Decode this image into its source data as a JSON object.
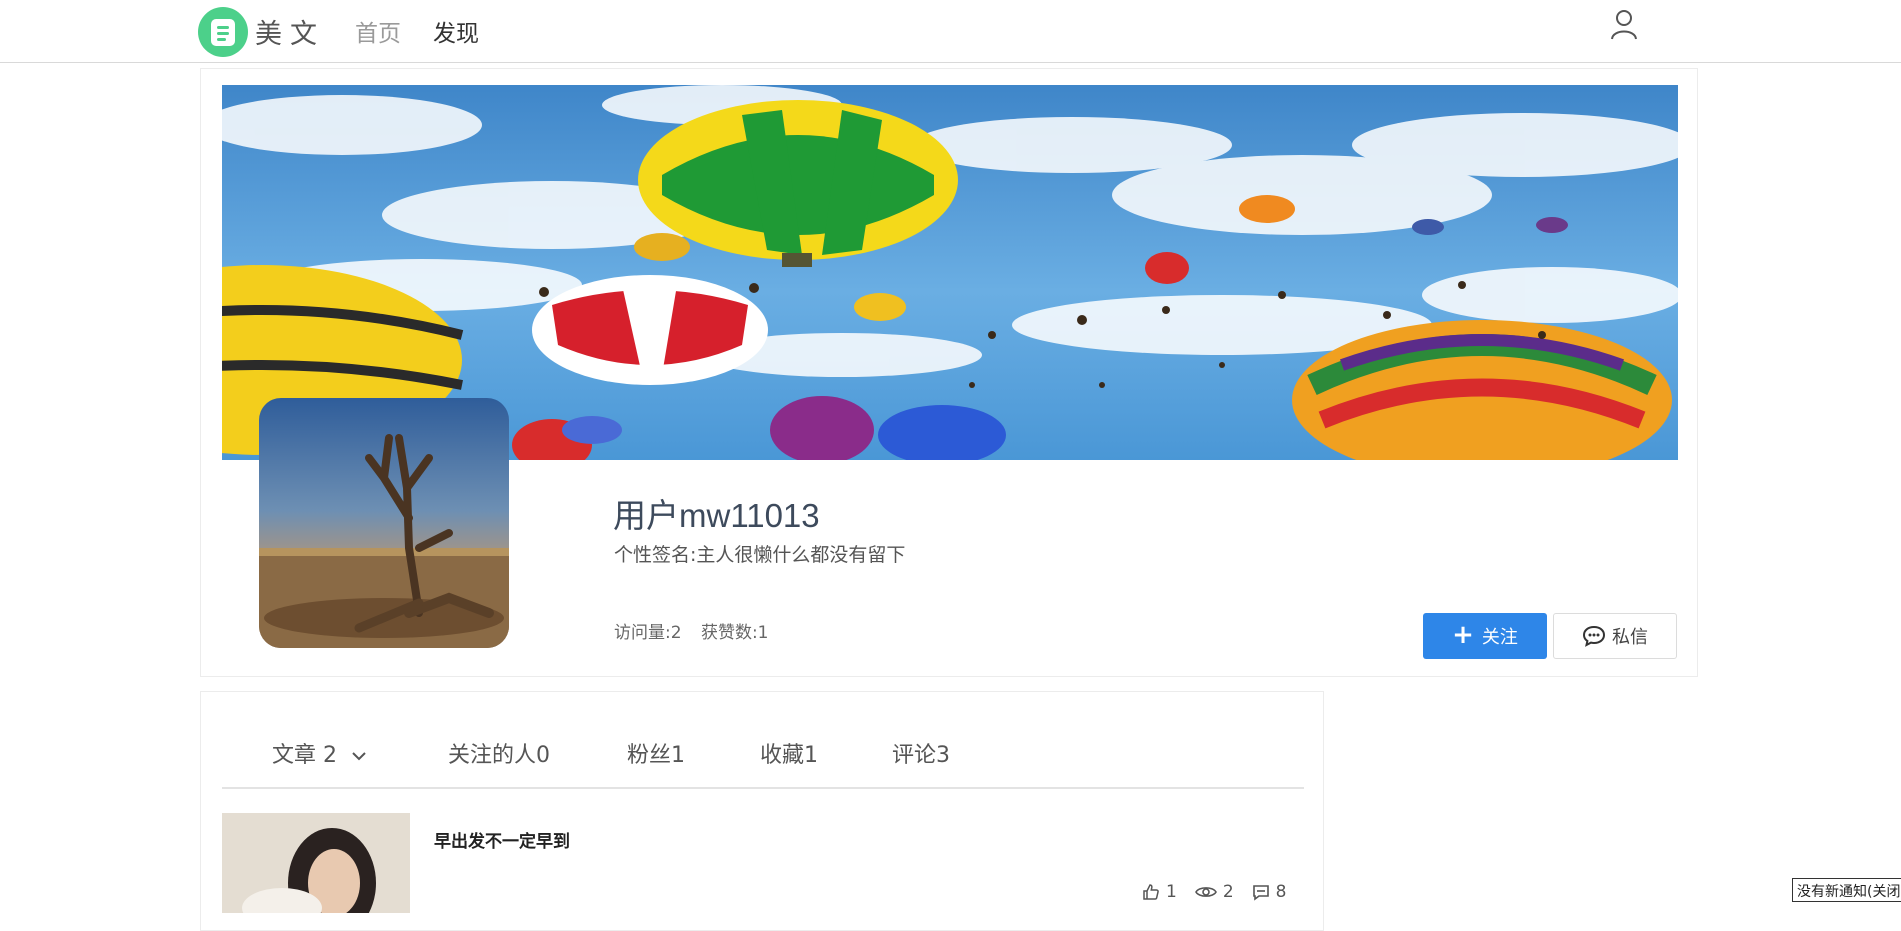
{
  "header": {
    "logo_text": "美文",
    "logo_icon": "document-icon",
    "nav": [
      {
        "label": "首页"
      },
      {
        "label": "发现"
      }
    ],
    "user_icon": "user-icon"
  },
  "profile": {
    "username": "用户mw11013",
    "signature": "个性签名:主人很懒什么都没有留下",
    "visits_label": "访问量:2",
    "likes_label": "获赞数:1",
    "follow_button": "关注",
    "message_button": "私信"
  },
  "tabs": [
    {
      "label": "文章 2"
    },
    {
      "label": "关注的人0"
    },
    {
      "label": "粉丝1"
    },
    {
      "label": "收藏1"
    },
    {
      "label": "评论3"
    }
  ],
  "articles": [
    {
      "title": "早出发不一定早到",
      "likes": "1",
      "views": "2",
      "comments": "8"
    }
  ],
  "notification": "没有新通知(关闭",
  "colors": {
    "brand": "#4cd08a",
    "primary_button": "#2e86e8"
  }
}
